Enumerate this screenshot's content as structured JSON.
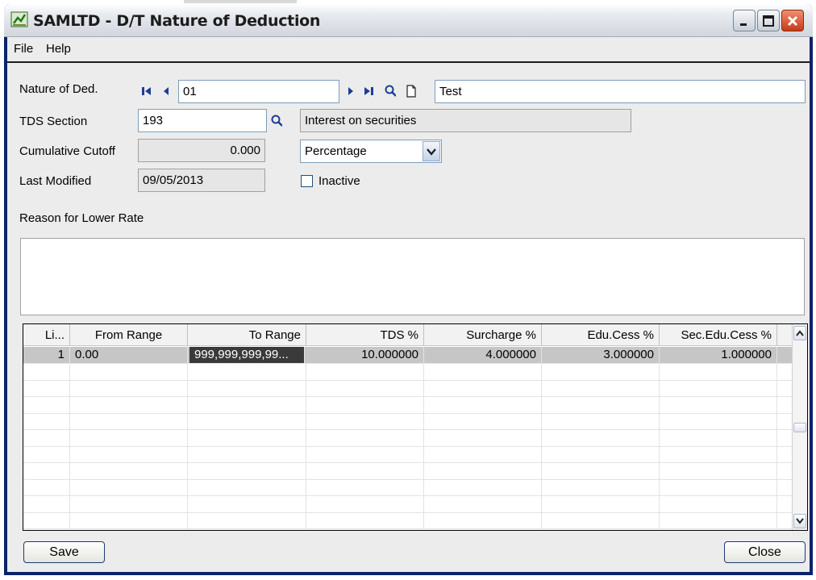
{
  "window": {
    "title": "SAMLTD - D/T Nature of Deduction"
  },
  "menu": {
    "file": "File",
    "help": "Help"
  },
  "form": {
    "nature_label": "Nature of Ded.",
    "nature_code": "01",
    "nature_desc": "Test",
    "tds_label": "TDS Section",
    "tds_value": "193",
    "tds_desc": "Interest on securities",
    "cutoff_label": "Cumulative Cutoff",
    "cutoff_value": "0.000",
    "cutoff_type": "Percentage",
    "modified_label": "Last Modified",
    "modified_value": "09/05/2013",
    "inactive_label": "Inactive",
    "inactive_checked": false,
    "reason_label": "Reason for Lower Rate",
    "reason_value": ""
  },
  "grid": {
    "columns": [
      "Li...",
      "From Range",
      "To Range",
      "TDS %",
      "Surcharge %",
      "Edu.Cess %",
      "Sec.Edu.Cess %"
    ],
    "rows": [
      [
        "1",
        "0.00",
        "999,999,999,99...",
        "10.000000",
        "4.000000",
        "3.000000",
        "1.000000"
      ]
    ]
  },
  "buttons": {
    "save": "Save",
    "close": "Close"
  },
  "icons": [
    "app-icon",
    "first-record-icon",
    "previous-record-icon",
    "next-record-icon",
    "last-record-icon",
    "finder-icon",
    "new-document-icon",
    "minimize-icon",
    "maximize-icon",
    "close-icon",
    "dropdown-arrow-icon",
    "scroll-up-icon",
    "scroll-down-icon"
  ],
  "colors": {
    "titlebar_accent": "#0a246a",
    "window_bg": "#ececec",
    "nav_icon": "#1c3f94"
  }
}
